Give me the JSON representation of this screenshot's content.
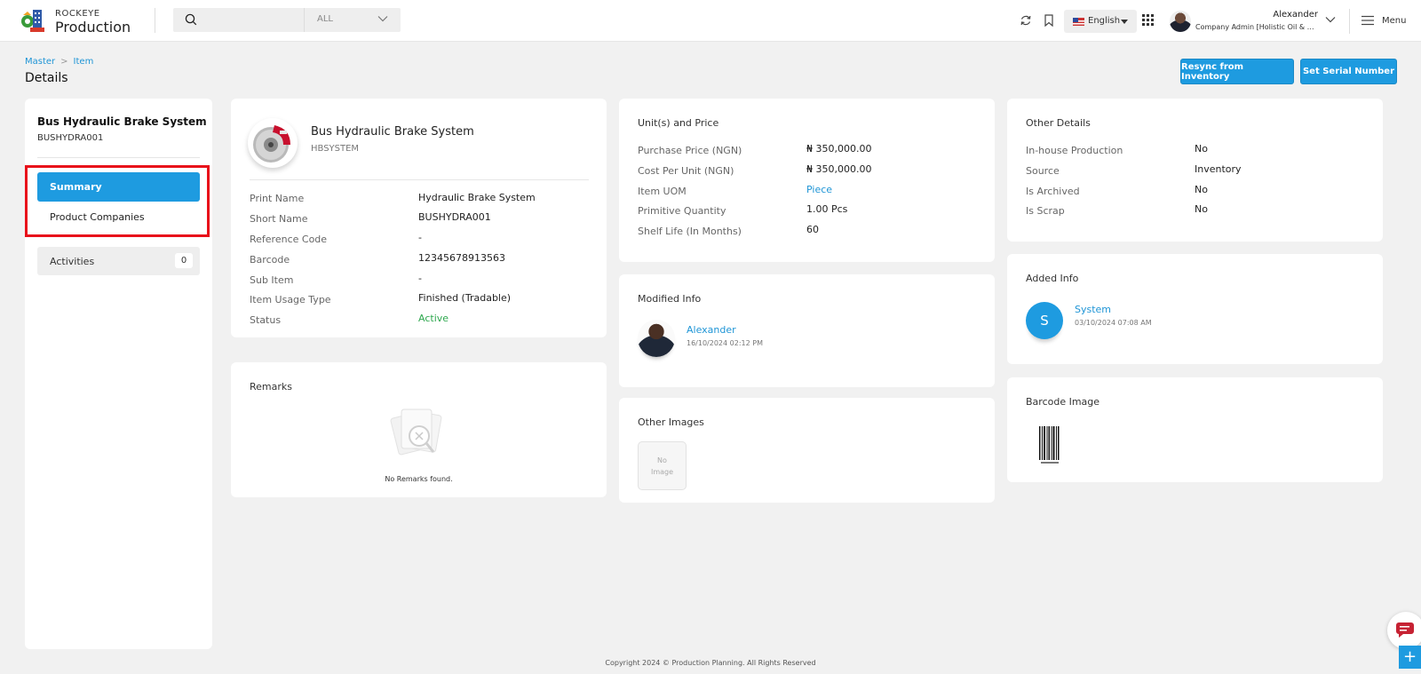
{
  "header": {
    "brand_small": "ROCKEYE",
    "brand_big": "Production",
    "search_scope": "ALL",
    "language": "English",
    "user_name": "Alexander",
    "user_role": "Company Admin [Holistic Oil & Ga...",
    "menu_label": "Menu"
  },
  "breadcrumb": {
    "master": "Master",
    "item": "Item"
  },
  "page_title": "Details",
  "actions": {
    "resync": "Resync from Inventory",
    "serial": "Set Serial Number"
  },
  "sidebar": {
    "title": "Bus Hydraulic Brake System",
    "code": "BUSHYDRA001",
    "nav": {
      "summary": "Summary",
      "companies": "Product Companies"
    },
    "activities_label": "Activities",
    "activities_count": "0"
  },
  "item": {
    "name": "Bus Hydraulic Brake System",
    "code": "HBSYSTEM",
    "fields": [
      {
        "label": "Print Name",
        "value": "Hydraulic Brake System"
      },
      {
        "label": "Short Name",
        "value": "BUSHYDRA001"
      },
      {
        "label": "Reference Code",
        "value": "-"
      },
      {
        "label": "Barcode",
        "value": "12345678913563"
      },
      {
        "label": "Sub Item",
        "value": "-"
      },
      {
        "label": "Item Usage Type",
        "value": "Finished (Tradable)"
      },
      {
        "label": "Status",
        "value": "Active"
      }
    ]
  },
  "remarks": {
    "title": "Remarks",
    "empty": "No Remarks found."
  },
  "units": {
    "title": "Unit(s) and Price",
    "fields": [
      {
        "label": "Purchase Price (NGN)",
        "value": "₦ 350,000.00"
      },
      {
        "label": "Cost Per Unit (NGN)",
        "value": "₦ 350,000.00"
      },
      {
        "label": "Item UOM",
        "value": "Piece"
      },
      {
        "label": "Primitive Quantity",
        "value": "1.00 Pcs"
      },
      {
        "label": "Shelf Life (In Months)",
        "value": "60"
      }
    ]
  },
  "modified": {
    "title": "Modified Info",
    "name": "Alexander",
    "date": "16/10/2024 02:12 PM"
  },
  "other_images": {
    "title": "Other Images",
    "no_image_1": "No",
    "no_image_2": "Image"
  },
  "other": {
    "title": "Other Details",
    "fields": [
      {
        "label": "In-house Production",
        "value": "No"
      },
      {
        "label": "Source",
        "value": "Inventory"
      },
      {
        "label": "Is Archived",
        "value": "No"
      },
      {
        "label": "Is Scrap",
        "value": "No"
      }
    ]
  },
  "added": {
    "title": "Added Info",
    "initial": "S",
    "name": "System",
    "date": "03/10/2024 07:08 AM"
  },
  "barcode_image": {
    "title": "Barcode Image"
  },
  "footer": {
    "copyright": "Copyright 2024 © Production Planning. All Rights Reserved"
  },
  "colors": {
    "primary": "#1e9be0",
    "highlight": "#e8101a",
    "active": "#2fa84f",
    "background": "#f1f1f1"
  },
  "icons": [
    "rockeye-logo",
    "search-icon",
    "chevron-down-icon",
    "refresh-icon",
    "bookmark-icon",
    "grid-icon",
    "hamburger-icon",
    "chat-icon",
    "plus-icon"
  ]
}
